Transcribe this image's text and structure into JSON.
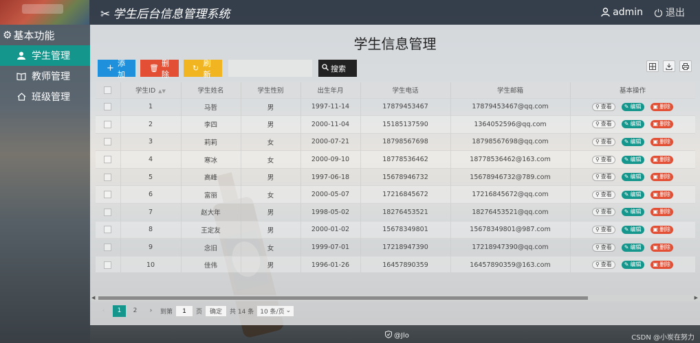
{
  "header": {
    "title": "学生后台信息管理系统",
    "user": "admin",
    "logout": "退出"
  },
  "sidebar": {
    "heading": "基本功能",
    "items": [
      {
        "label": "学生管理",
        "active": true
      },
      {
        "label": "教师管理",
        "active": false
      },
      {
        "label": "班级管理",
        "active": false
      }
    ]
  },
  "main": {
    "title": "学生信息管理",
    "toolbar": {
      "add": "添加",
      "delete": "删除",
      "refresh": "刷新",
      "search_placeholder": "",
      "search": "搜索"
    },
    "columns": [
      "学生ID",
      "学生姓名",
      "学生性别",
      "出生年月",
      "学生电话",
      "学生邮箱",
      "基本操作"
    ],
    "rows": [
      [
        "1",
        "马哲",
        "男",
        "1997-11-14",
        "17879453467",
        "17879453467@qq.com"
      ],
      [
        "2",
        "李四",
        "男",
        "2000-11-04",
        "15185137590",
        "1364052596@qq.com"
      ],
      [
        "3",
        "莉莉",
        "女",
        "2000-07-21",
        "18798567698",
        "18798567698@qq.com"
      ],
      [
        "4",
        "寒冰",
        "女",
        "2000-09-10",
        "18778536462",
        "18778536462@163.com"
      ],
      [
        "5",
        "高峰",
        "男",
        "1997-06-18",
        "15678946732",
        "15678946732@789.com"
      ],
      [
        "6",
        "富丽",
        "女",
        "2000-05-07",
        "17216845672",
        "17216845672@qq.com"
      ],
      [
        "7",
        "赵大年",
        "男",
        "1998-05-02",
        "18276453521",
        "18276453521@qq.com"
      ],
      [
        "8",
        "王定友",
        "男",
        "2000-01-02",
        "15678349801",
        "15678349801@987.com"
      ],
      [
        "9",
        "念旧",
        "女",
        "1999-07-01",
        "17218947390",
        "17218947390@qq.com"
      ],
      [
        "10",
        "佳伟",
        "男",
        "1996-01-26",
        "16457890359",
        "16457890359@163.com"
      ]
    ],
    "ops": {
      "view": "查看",
      "edit": "编辑",
      "delete": "删除"
    },
    "pager": {
      "pages": [
        "1",
        "2"
      ],
      "goto": "到第",
      "current_input": "1",
      "page_unit": "页",
      "confirm": "确定",
      "total": "共 14 条",
      "page_size": "10 条/页"
    }
  },
  "footer": {
    "center": "@Jlo",
    "right": "CSDN @小炭在努力"
  }
}
